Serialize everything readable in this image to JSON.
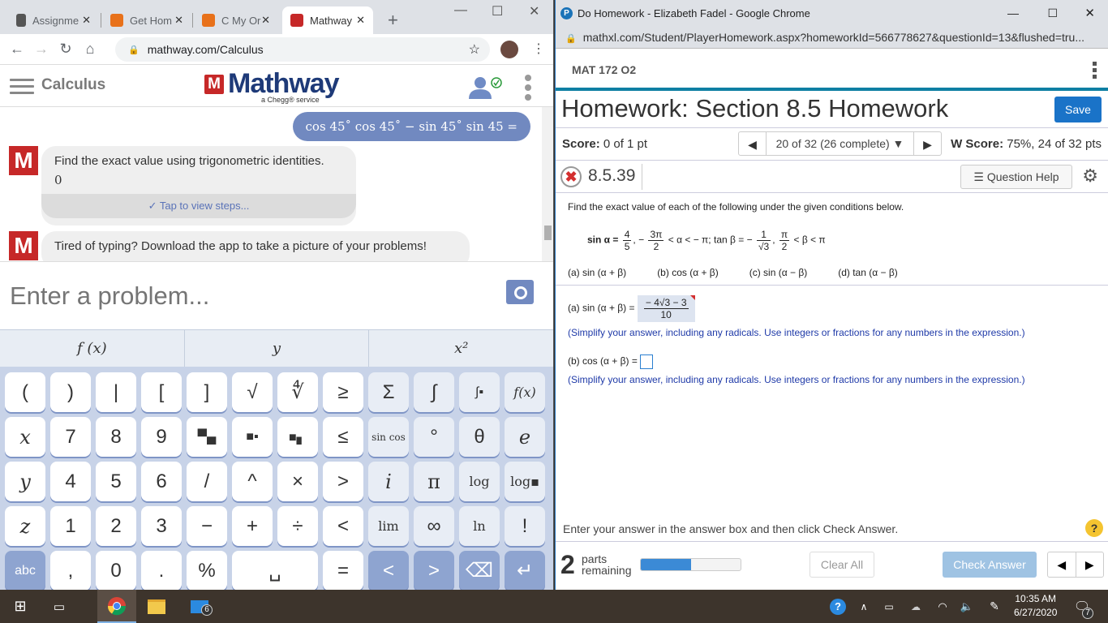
{
  "left_browser": {
    "tabs": [
      {
        "label": "Assignme",
        "icon": "document-icon"
      },
      {
        "label": "Get Hom",
        "icon": "chegg-icon"
      },
      {
        "label": "C My Or",
        "icon": "chegg-icon"
      },
      {
        "label": "Mathway",
        "icon": "mathway-icon",
        "active": true
      }
    ],
    "new_tab": "+",
    "url": "mathway.com/Calculus",
    "window_controls": {
      "minimize": "—",
      "maximize": "☐",
      "close": "✕"
    }
  },
  "mathway": {
    "category": "Calculus",
    "logo_letter": "M",
    "logo_text": "Mathway",
    "logo_sub": "a Chegg® service",
    "user_message": "cos 45˚ cos 45˚ − sin 45˚ sin 45 =",
    "bot_messages": [
      {
        "text": "Find the exact value using trigonometric identities.",
        "answer": "0",
        "steps_link": "Tap to view steps..."
      },
      {
        "text": "Tired of typing? Download the app to take a picture of your problems!"
      }
    ],
    "input_placeholder": "Enter a problem...",
    "keyboard_tabs": [
      "f (x)",
      "y",
      "x²"
    ],
    "keys": [
      [
        "(",
        ")",
        "|",
        "[",
        "]",
        "√",
        "∜",
        "≥",
        "Σ",
        "∫",
        "∫▪",
        "f(x)"
      ],
      [
        "x",
        "7",
        "8",
        "9",
        "▀▄",
        "■▪",
        "■▖",
        "≤",
        "sin cos",
        "°",
        "θ",
        "e"
      ],
      [
        "y",
        "4",
        "5",
        "6",
        "/",
        "^",
        "×",
        ">",
        "i",
        "π",
        "log",
        "log▪"
      ],
      [
        "z",
        "1",
        "2",
        "3",
        "−",
        "+",
        "÷",
        "<",
        "lim",
        "∞",
        "ln",
        "!"
      ],
      [
        "abc",
        ",",
        "0",
        ".",
        "%",
        "␣",
        "=",
        "<",
        ">",
        "⌫",
        "↵"
      ]
    ]
  },
  "right_browser": {
    "window_title": "Do Homework - Elizabeth Fadel - Google Chrome",
    "url": "mathxl.com/Student/PlayerHomework.aspx?homeworkId=566778627&questionId=13&flushed=tru..."
  },
  "mathxl": {
    "course": "MAT 172 O2",
    "title": "Homework: Section 8.5 Homework",
    "save_label": "Save",
    "score_label": "Score:",
    "score_value": "0 of 1 pt",
    "pager_text": "20 of 32 (26 complete) ▼",
    "hw_score_label": "W Score:",
    "hw_score_value": "75%, 24 of 32 pts",
    "question_number": "8.5.39",
    "question_help": "Question Help",
    "prompt": "Find the exact value of each of the following under the given conditions below.",
    "given": {
      "sin_alpha": "sin α =",
      "sin_num": "4",
      "sin_den": "5",
      "alpha_lo_num": "3π",
      "alpha_lo_den": "2",
      "alpha_range_mid": "< α < − π; tan β = −",
      "tan_num": "1",
      "tan_den": "√3",
      "beta_lo_num": "π",
      "beta_lo_den": "2",
      "beta_range": "< β < π"
    },
    "parts": [
      "(a) sin (α + β)",
      "(b) cos (α + β)",
      "(c) sin (α − β)",
      "(d) tan (α − β)"
    ],
    "answer_a_label": "(a) sin (α + β) =",
    "answer_a_num": "− 4√3 − 3",
    "answer_a_den": "10",
    "answer_b_label": "(b) cos (α + β) =",
    "hint": "(Simplify your answer, including any radicals. Use integers or fractions for any numbers in the expression.)",
    "instruction": "Enter your answer in the answer box and then click Check Answer.",
    "parts_remaining_count": "2",
    "parts_remaining_label": "parts remaining",
    "progress_fraction": 0.5,
    "clear_all": "Clear All",
    "check_answer": "Check Answer"
  },
  "taskbar": {
    "time": "10:35 AM",
    "date": "6/27/2020",
    "mail_badge": "6",
    "notification_badge": "7"
  }
}
